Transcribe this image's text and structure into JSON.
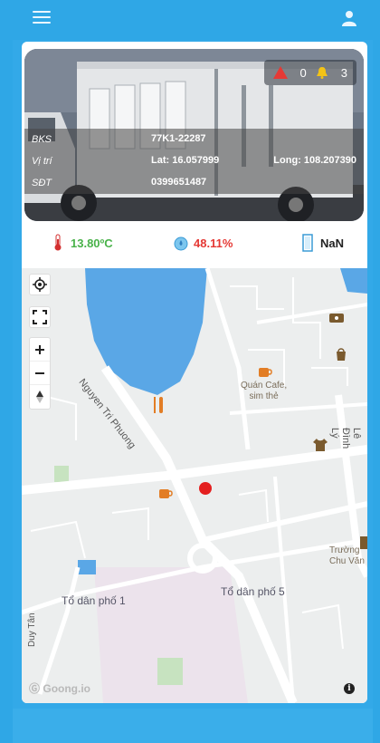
{
  "vehicle": {
    "bks_label": "BKS",
    "plate": "77K1-22287",
    "location_label": "Vị trí",
    "lat": "Lat: 16.057999",
    "long": "Long: 108.207390",
    "phone_label": "SĐT",
    "phone": "0399651487"
  },
  "alerts": {
    "danger_count": "0",
    "warning_count": "3"
  },
  "sensors": {
    "temperature": "13.80ºC",
    "humidity": "48.11%",
    "door": "NaN"
  },
  "map": {
    "streets": {
      "nguyen_tri_phuong": "Nguyen Tri Phuong",
      "le_dinh_ly": "Lê Đình Lý",
      "duy_tan": "Duy Tân"
    },
    "areas": {
      "to_dan_pho_1": "Tổ dân phố 1",
      "to_dan_pho_5": "Tổ dân phố 5"
    },
    "poi_cafe": "Quán Cafe,",
    "poi_cafe_2": "sim thẻ",
    "poi_school_1": "Trường",
    "poi_school_2": "Chu Văn",
    "logo": "Goong.io",
    "info": "i"
  },
  "colors": {
    "primary": "#2fa7e6",
    "temperature": "#49b24a",
    "humidity": "#e53935",
    "marker": "#e41f1f",
    "danger": "#e53935",
    "warning": "#f3c316"
  },
  "icons": {
    "menu": "menu-icon",
    "user": "user-icon",
    "thermometer": "thermometer-icon",
    "humidity": "humidity-icon",
    "door": "door-icon",
    "locate": "crosshair-icon",
    "fullscreen": "fullscreen-icon",
    "zoom_in": "plus-icon",
    "zoom_out": "minus-icon",
    "compass": "compass-icon"
  }
}
